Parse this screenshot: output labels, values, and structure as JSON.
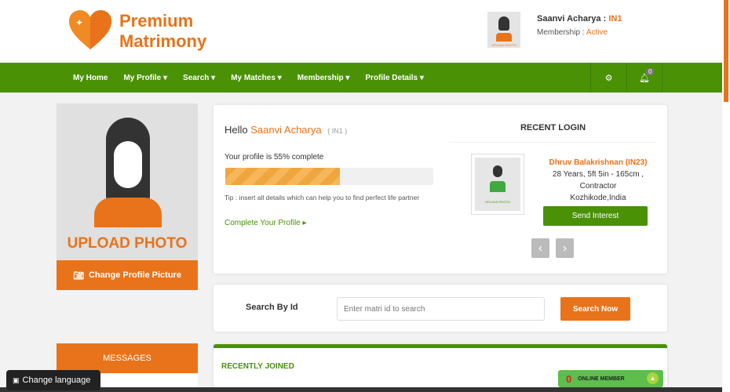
{
  "brand": {
    "line1": "Premium",
    "line2": "Matrimony"
  },
  "user": {
    "name": "Saanvi Acharya",
    "id": "IN1",
    "membership_label": "Membership :",
    "membership_status": "Active",
    "avatar_caption": "UPLOAD PHOTO"
  },
  "nav": {
    "items": [
      "My Home",
      "My Profile ▾",
      "Search ▾",
      "My Matches ▾",
      "Membership ▾",
      "Profile Details ▾"
    ],
    "notif_count": "0"
  },
  "sidebar": {
    "upload_photo": "UPLOAD PHOTO",
    "change_picture": "Change Profile Picture",
    "messages": "MESSAGES"
  },
  "welcome": {
    "hello": "Hello",
    "name": "Saanvi Acharya",
    "id": "( IN1 )",
    "progress_text": "Your profile is 55% complete",
    "progress_percent": 55,
    "tip": "Tip : insert all details which can help you to find perfect life partner",
    "complete_link": "Complete Your Profile ▸"
  },
  "recent_login": {
    "title": "RECENT LOGIN",
    "name": "Dhruv Balakrishnan  (IN23)",
    "line1": "28 Years, 5ft 5in - 165cm ,",
    "line2": "Contractor",
    "line3": "Kozhikode,India",
    "photo_caption": "UPLOAD PHOTO",
    "send_interest": "Send Interest",
    "prev": "‹",
    "next": "›"
  },
  "search": {
    "label": "Search By Id",
    "placeholder": "Enter matri id to search",
    "button": "Search Now"
  },
  "recently_joined": {
    "title": "RECENTLY JOINED"
  },
  "online": {
    "count": "0",
    "label": "ONLINE MEMBER"
  },
  "language": {
    "label": "Change language"
  }
}
